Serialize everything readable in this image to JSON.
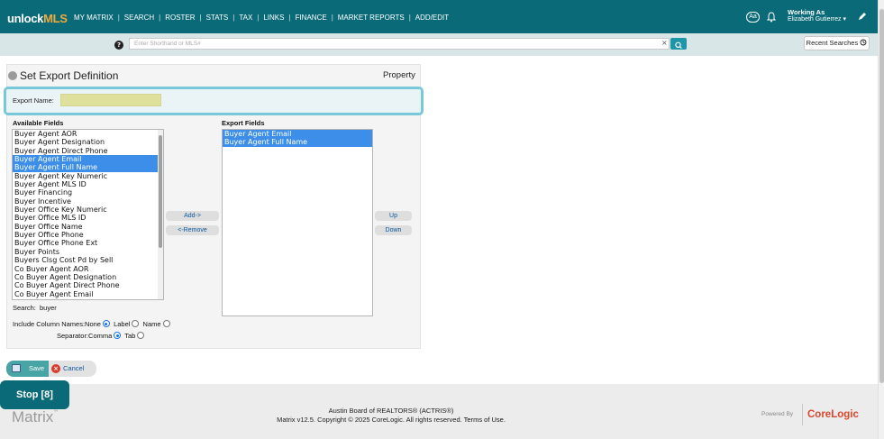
{
  "brand": {
    "logo_unlock": "unlock",
    "logo_mls": "MLS"
  },
  "nav": [
    "MY MATRIX",
    "SEARCH",
    "ROSTER",
    "STATS",
    "TAX",
    "LINKS",
    "FINANCE",
    "MARKET REPORTS",
    "ADD/EDIT"
  ],
  "header": {
    "font_size_btn": "Aa",
    "working_as_label": "Working As",
    "user_name": "Elizabeth Gutierrez ▾"
  },
  "search": {
    "placeholder": "Enter Shorthand or MLS#",
    "clear": "×",
    "recent_label": "Recent Searches"
  },
  "export": {
    "title": "Set Export Definition",
    "property_label": "Property",
    "export_name_label": "Export Name:",
    "export_name_value": "",
    "available_fields_label": "Available Fields",
    "export_fields_label": "Export Fields",
    "available_fields": [
      {
        "label": "Buyer Agent AOR",
        "selected": false
      },
      {
        "label": "Buyer Agent Designation",
        "selected": false
      },
      {
        "label": "Buyer Agent Direct Phone",
        "selected": false
      },
      {
        "label": "Buyer Agent Email",
        "selected": true
      },
      {
        "label": "Buyer Agent Full Name",
        "selected": true
      },
      {
        "label": "Buyer Agent Key Numeric",
        "selected": false
      },
      {
        "label": "Buyer Agent MLS ID",
        "selected": false
      },
      {
        "label": "Buyer Financing",
        "selected": false
      },
      {
        "label": "Buyer Incentive",
        "selected": false
      },
      {
        "label": "Buyer Office Key Numeric",
        "selected": false
      },
      {
        "label": "Buyer Office MLS ID",
        "selected": false
      },
      {
        "label": "Buyer Office Name",
        "selected": false
      },
      {
        "label": "Buyer Office Phone",
        "selected": false
      },
      {
        "label": "Buyer Office Phone Ext",
        "selected": false
      },
      {
        "label": "Buyer Points",
        "selected": false
      },
      {
        "label": "Buyers Clsg Cost Pd by Sell",
        "selected": false
      },
      {
        "label": "Co Buyer Agent AOR",
        "selected": false
      },
      {
        "label": "Co Buyer Agent Designation",
        "selected": false
      },
      {
        "label": "Co Buyer Agent Direct Phone",
        "selected": false
      },
      {
        "label": "Co Buyer Agent Email",
        "selected": false
      }
    ],
    "export_fields": [
      {
        "label": "Buyer Agent Email",
        "selected": true
      },
      {
        "label": "Buyer Agent Full Name",
        "selected": true
      }
    ],
    "add_label": "Add->",
    "remove_label": "<-Remove",
    "up_label": "Up",
    "down_label": "Down",
    "search_label": "Search:",
    "search_value": "buyer",
    "include_column_names_label": "Include Column Names:",
    "col_opt_none": "None",
    "col_opt_label": "Label",
    "col_opt_name": "Name",
    "separator_label": "Separator:",
    "sep_opt_comma": "Comma",
    "sep_opt_tab": "Tab"
  },
  "actions": {
    "save_label": "Save",
    "cancel_label": "Cancel",
    "cancel_icon": "×"
  },
  "footer": {
    "matrix_label": "Matrix",
    "tm": "™",
    "line1": "Austin Board of REALTORS® (ACTRIS®)",
    "line2": "Matrix v12.5. Copyright © 2025 CoreLogic. All rights reserved.",
    "terms": "Terms of Use.",
    "powered_by": "Powered By",
    "corelogic": "CoreLogic"
  },
  "stop_button": "Stop [8]",
  "help_icon": "?",
  "colors": {
    "brand_teal": "#0b6a77",
    "selected_blue": "#3d8ee8",
    "export_name_yellow": "#dfe09b",
    "corelogic_red": "#d9462f"
  }
}
